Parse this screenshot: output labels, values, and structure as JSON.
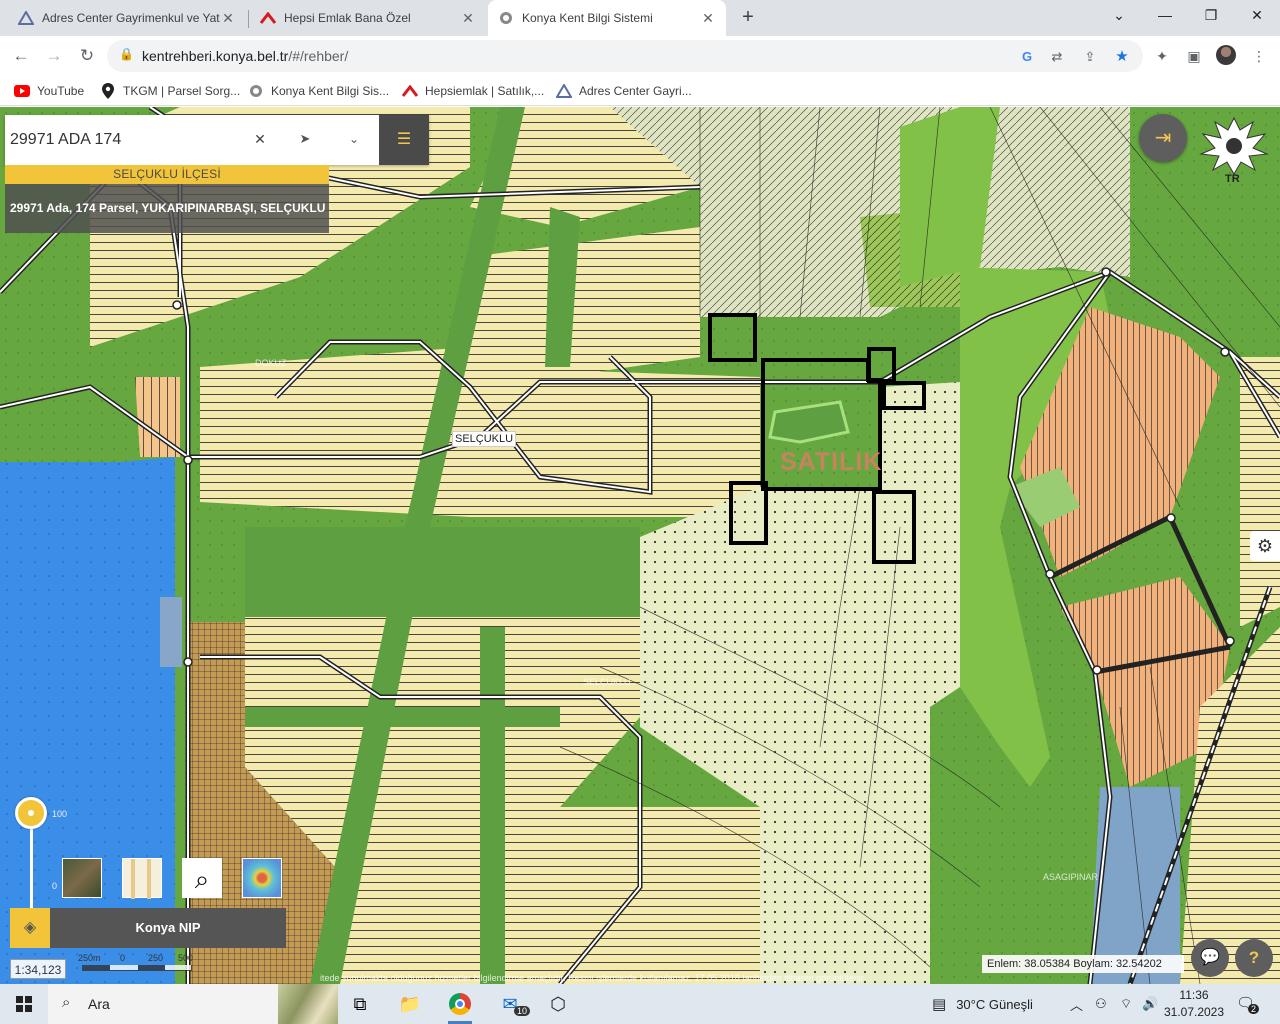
{
  "browser": {
    "tabs": [
      {
        "title": "Adres Center Gayrimenkul ve Yat",
        "icon": "adres-center-logo"
      },
      {
        "title": "Hepsi Emlak Bana Özel",
        "icon": "hepsiemlak-logo"
      },
      {
        "title": "Konya Kent Bilgi Sistemi",
        "icon": "konya-logo",
        "active": true
      }
    ],
    "url_host": "kentrehberi.konya.bel.tr",
    "url_path": "/#/rehber/",
    "bookmarks": [
      {
        "label": "YouTube",
        "icon": "youtube-icon"
      },
      {
        "label": "TKGM | Parsel Sorg...",
        "icon": "map-pin-icon"
      },
      {
        "label": "Konya Kent Bilgi Sis...",
        "icon": "konya-logo"
      },
      {
        "label": "Hepsiemlak | Satılık,...",
        "icon": "hepsiemlak-logo"
      },
      {
        "label": "Adres Center Gayri...",
        "icon": "adres-center-logo"
      }
    ]
  },
  "map_app": {
    "search_value": "29971 ADA 174",
    "district": "SELÇUKLU İLÇESİ",
    "parcel_info": "29971 Ada, 174 Parsel, YUKARIPINARBAŞI, SELÇUKLU",
    "map_labels": {
      "district_label": "SELÇUKLU",
      "sale_label": "SATILIK",
      "faint_1": "DOKUZ",
      "faint_2": "SELÇUKLU",
      "faint_3": "ASAGIPINAR"
    },
    "logo_text": "TR",
    "opacity_max": "100",
    "opacity_min": "0",
    "layer_name": "Konya NIP",
    "scale_ratio": "1:34,123",
    "scale_labels": [
      "250m",
      "0",
      "250",
      "500"
    ],
    "disclaimer": "itede sunulmakta olduğunuz hizmetler bilgilendirme amaçlıdır. Resmi işlemlerde kullanılamaz. 17.05.2018 tarihinden itibaren görüntülenir",
    "coordinates": "Enlem: 38.05384 Boylam: 32.54202"
  },
  "taskbar": {
    "search_placeholder": "Ara",
    "mail_count": "10",
    "weather": "30°C Güneşli",
    "time": "11:36",
    "date": "31.07.2023",
    "notification_count": "2"
  }
}
